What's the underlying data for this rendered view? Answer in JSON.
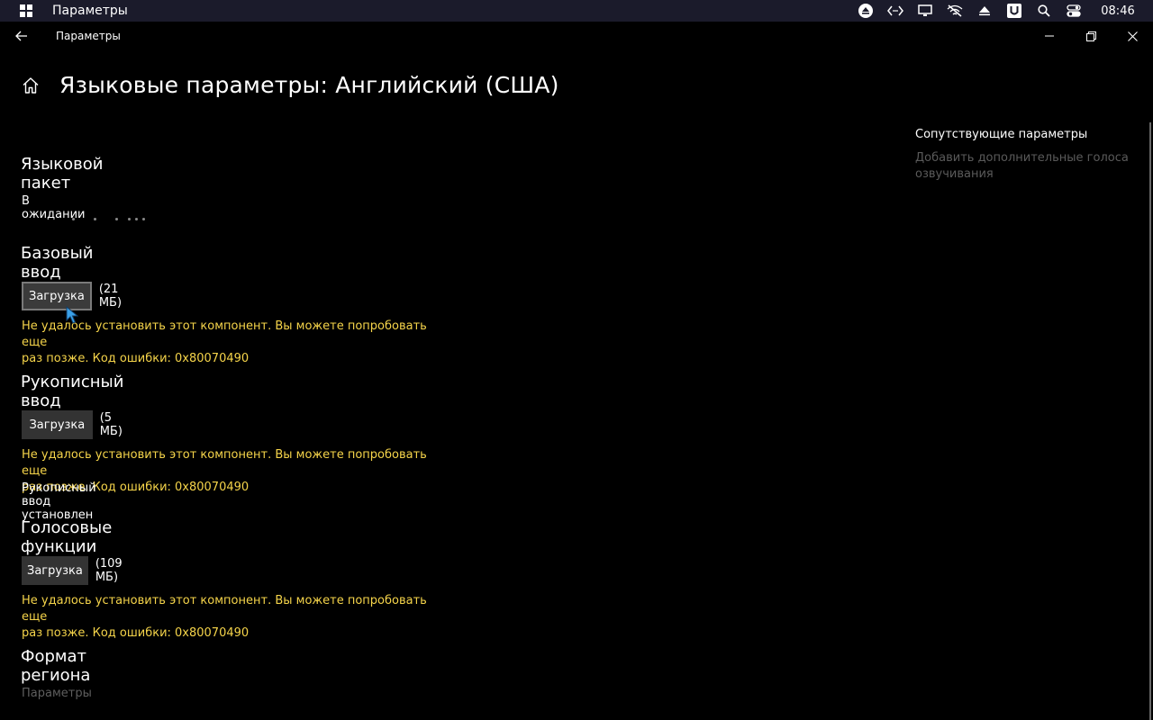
{
  "system_bar": {
    "app_title": "Параметры",
    "clock": "08:46",
    "tray_icons": [
      "eject-icon",
      "code-icon",
      "monitor-icon",
      "wifi-off-icon",
      "tray-arrow-icon",
      "u-app-icon",
      "search-icon",
      "toggle-icon"
    ]
  },
  "window": {
    "title": "Параметры"
  },
  "page": {
    "title": "Языковые параметры: Английский (США)"
  },
  "sections": {
    "language_pack": {
      "title": "Языковой пакет",
      "status": "В ожидании"
    },
    "basic_typing": {
      "title": "Базовый ввод",
      "button_label": "Загрузка",
      "size": "(21 МБ)",
      "error_line1": "Не удалось установить этот компонент. Вы можете попробовать еще",
      "error_line2": "раз позже. Код ошибки: 0x80070490"
    },
    "handwriting": {
      "title": "Рукописный ввод",
      "button_label": "Загрузка",
      "size": "(5 МБ)",
      "error_line1": "Не удалось установить этот компонент. Вы можете попробовать еще",
      "error_line2": "раз позже. Код ошибки: 0x80070490",
      "installed_note": "Рукописный ввод установлен"
    },
    "speech": {
      "title": "Голосовые функции",
      "button_label": "Загрузка",
      "size": "(109 МБ)",
      "error_line1": "Не удалось установить этот компонент. Вы можете попробовать еще",
      "error_line2": "раз позже. Код ошибки: 0x80070490"
    },
    "region_format": {
      "title": "Формат региона",
      "settings_link": "Параметры"
    }
  },
  "related": {
    "title": "Сопутствующие параметры",
    "link_line1": "Добавить дополнительные голоса",
    "link_line2": "озвучивания"
  },
  "colors": {
    "background": "#000000",
    "system_bar": "#1b1b2b",
    "error_text": "#f5d44a",
    "button_bg": "#333333",
    "disabled_text": "#5a5a5a"
  }
}
